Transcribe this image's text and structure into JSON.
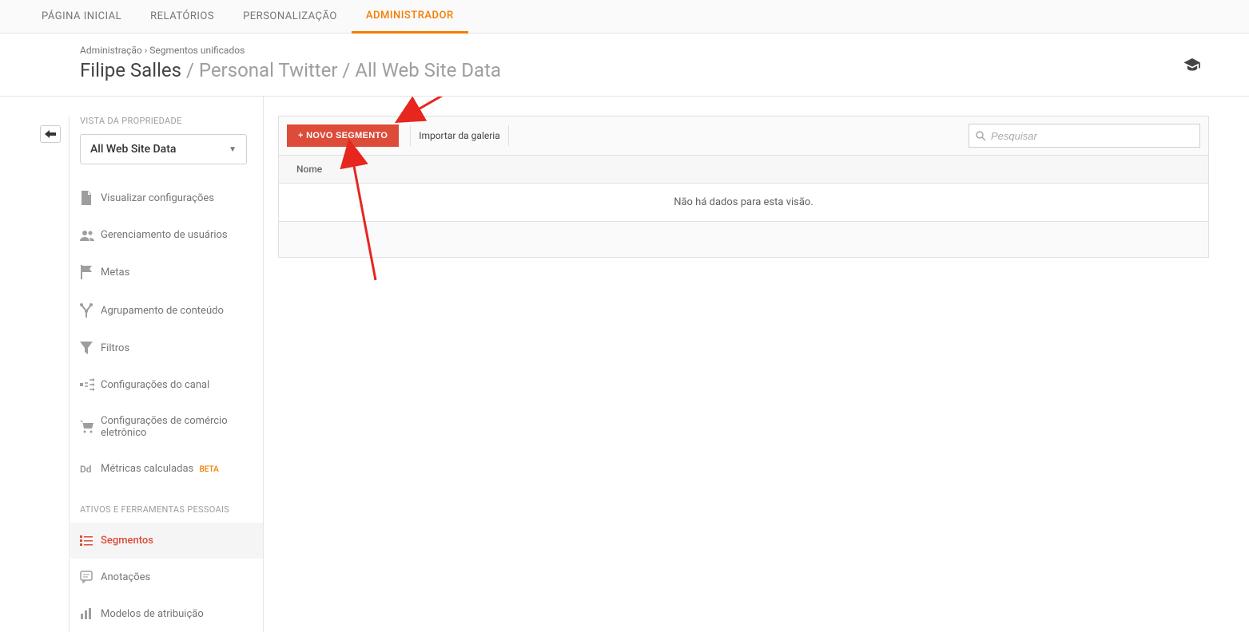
{
  "topNav": {
    "tabs": [
      {
        "label": "PÁGINA INICIAL",
        "active": false
      },
      {
        "label": "RELATÓRIOS",
        "active": false
      },
      {
        "label": "PERSONALIZAÇÃO",
        "active": false
      },
      {
        "label": "ADMINISTRADOR",
        "active": true
      }
    ]
  },
  "breadcrumb": {
    "root": "Administração",
    "sep": " › ",
    "current": "Segmentos unificados"
  },
  "header": {
    "account": "Filipe Salles",
    "path": " / Personal Twitter / All Web Site Data"
  },
  "sidebar": {
    "sectionLabel1": "VISTA DA PROPRIEDADE",
    "viewSelectValue": "All Web Site Data",
    "items1": [
      {
        "icon": "file-icon",
        "label": "Visualizar configurações"
      },
      {
        "icon": "users-icon",
        "label": "Gerenciamento de usuários"
      },
      {
        "icon": "flag-icon",
        "label": "Metas"
      },
      {
        "icon": "branch-icon",
        "label": "Agrupamento de conteúdo"
      },
      {
        "icon": "filter-icon",
        "label": "Filtros"
      },
      {
        "icon": "channel-icon",
        "label": "Configurações do canal"
      },
      {
        "icon": "cart-icon",
        "label": "Configurações de comércio eletrônico"
      },
      {
        "icon": "dd-icon",
        "label": "Métricas calculadas",
        "beta": "BETA"
      }
    ],
    "sectionLabel2": "ATIVOS E FERRAMENTAS PESSOAIS",
    "items2": [
      {
        "icon": "segments-icon",
        "label": "Segmentos",
        "active": true
      },
      {
        "icon": "annotations-icon",
        "label": "Anotações"
      },
      {
        "icon": "attribution-icon",
        "label": "Modelos de atribuição"
      }
    ]
  },
  "content": {
    "newSegmentBtn": "+ NOVO SEGMENTO",
    "importGallery": "Importar da galeria",
    "searchPlaceholder": "Pesquisar",
    "tableHeader": "Nome",
    "emptyMessage": "Não há dados para esta visão."
  }
}
